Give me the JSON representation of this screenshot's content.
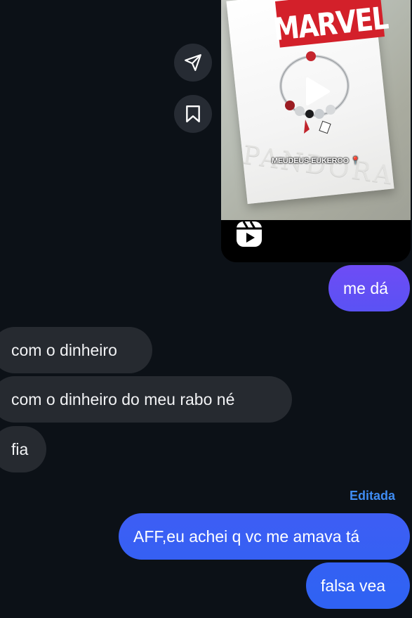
{
  "reel": {
    "brand_logo_text": "MARVEL",
    "box_text": "PANDORA",
    "caption": "MEUDEUS-EUKEROO 📍"
  },
  "side_actions": [
    {
      "icon": "send-icon"
    },
    {
      "icon": "bookmark-icon"
    }
  ],
  "messages": [
    {
      "direction": "outgoing",
      "text": "me dá"
    },
    {
      "direction": "incoming",
      "text": "com o dinheiro"
    },
    {
      "direction": "incoming",
      "text": "com o dinheiro do meu rabo né"
    },
    {
      "direction": "incoming",
      "text": "fia"
    },
    {
      "direction": "outgoing",
      "text": "AFF,eu achei q vc me amava tá",
      "edited": "Editada"
    },
    {
      "direction": "outgoing",
      "text": "falsa vea"
    }
  ],
  "colors": {
    "background": "#0c1117",
    "incoming_bubble": "#262a30",
    "outgoing_gradient_top": "#6e4cf5",
    "outgoing_gradient_bottom": "#2f62f3",
    "edited_label": "#3f8cf3"
  }
}
